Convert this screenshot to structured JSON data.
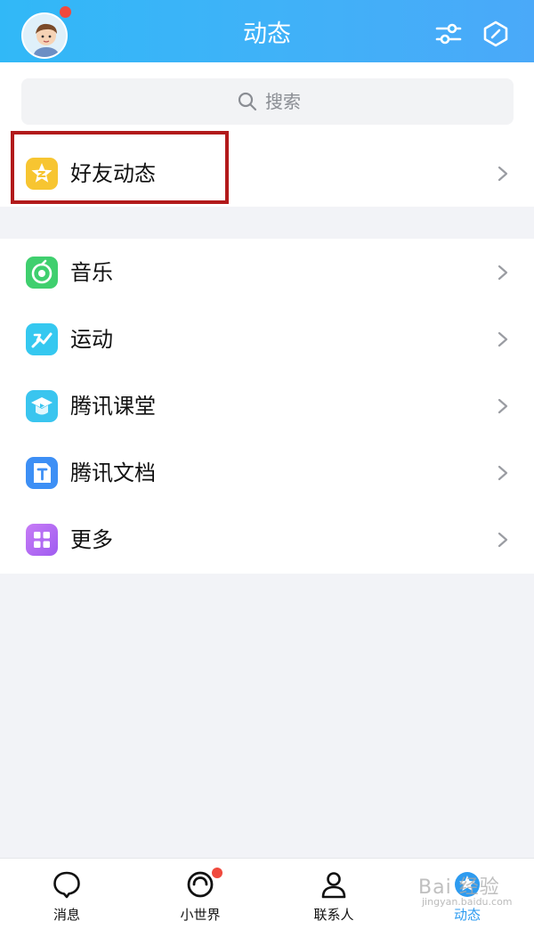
{
  "header": {
    "title": "动态",
    "avatar_icon": "avatar-icon",
    "settings_icon": "settings-sliders-icon",
    "shield_icon": "shield-icon",
    "brand_color": "#3fb2f8"
  },
  "search": {
    "placeholder": "搜索",
    "icon": "search-icon"
  },
  "friends_feed": {
    "label": "好友动态",
    "icon": "qzone-star-icon"
  },
  "menu": [
    {
      "label": "音乐",
      "icon": "music-icon",
      "color": "#3fcf6e"
    },
    {
      "label": "运动",
      "icon": "sport-icon",
      "color": "#35c8f0"
    },
    {
      "label": "腾讯课堂",
      "icon": "tencent-classroom-icon",
      "color": "#3ac5ef"
    },
    {
      "label": "腾讯文档",
      "icon": "tencent-docs-icon",
      "color": "#3d8ff5"
    },
    {
      "label": "更多",
      "icon": "more-grid-icon",
      "color": "#b56cf3"
    }
  ],
  "tabbar": {
    "items": [
      {
        "label": "消息",
        "icon": "message-icon"
      },
      {
        "label": "小世界",
        "icon": "small-world-icon"
      },
      {
        "label": "联系人",
        "icon": "contacts-icon"
      },
      {
        "label": "动态",
        "icon": "feed-icon",
        "active": true
      }
    ]
  },
  "watermark": {
    "text": "Bai 经验",
    "sub": "jingyan.baidu.com"
  }
}
